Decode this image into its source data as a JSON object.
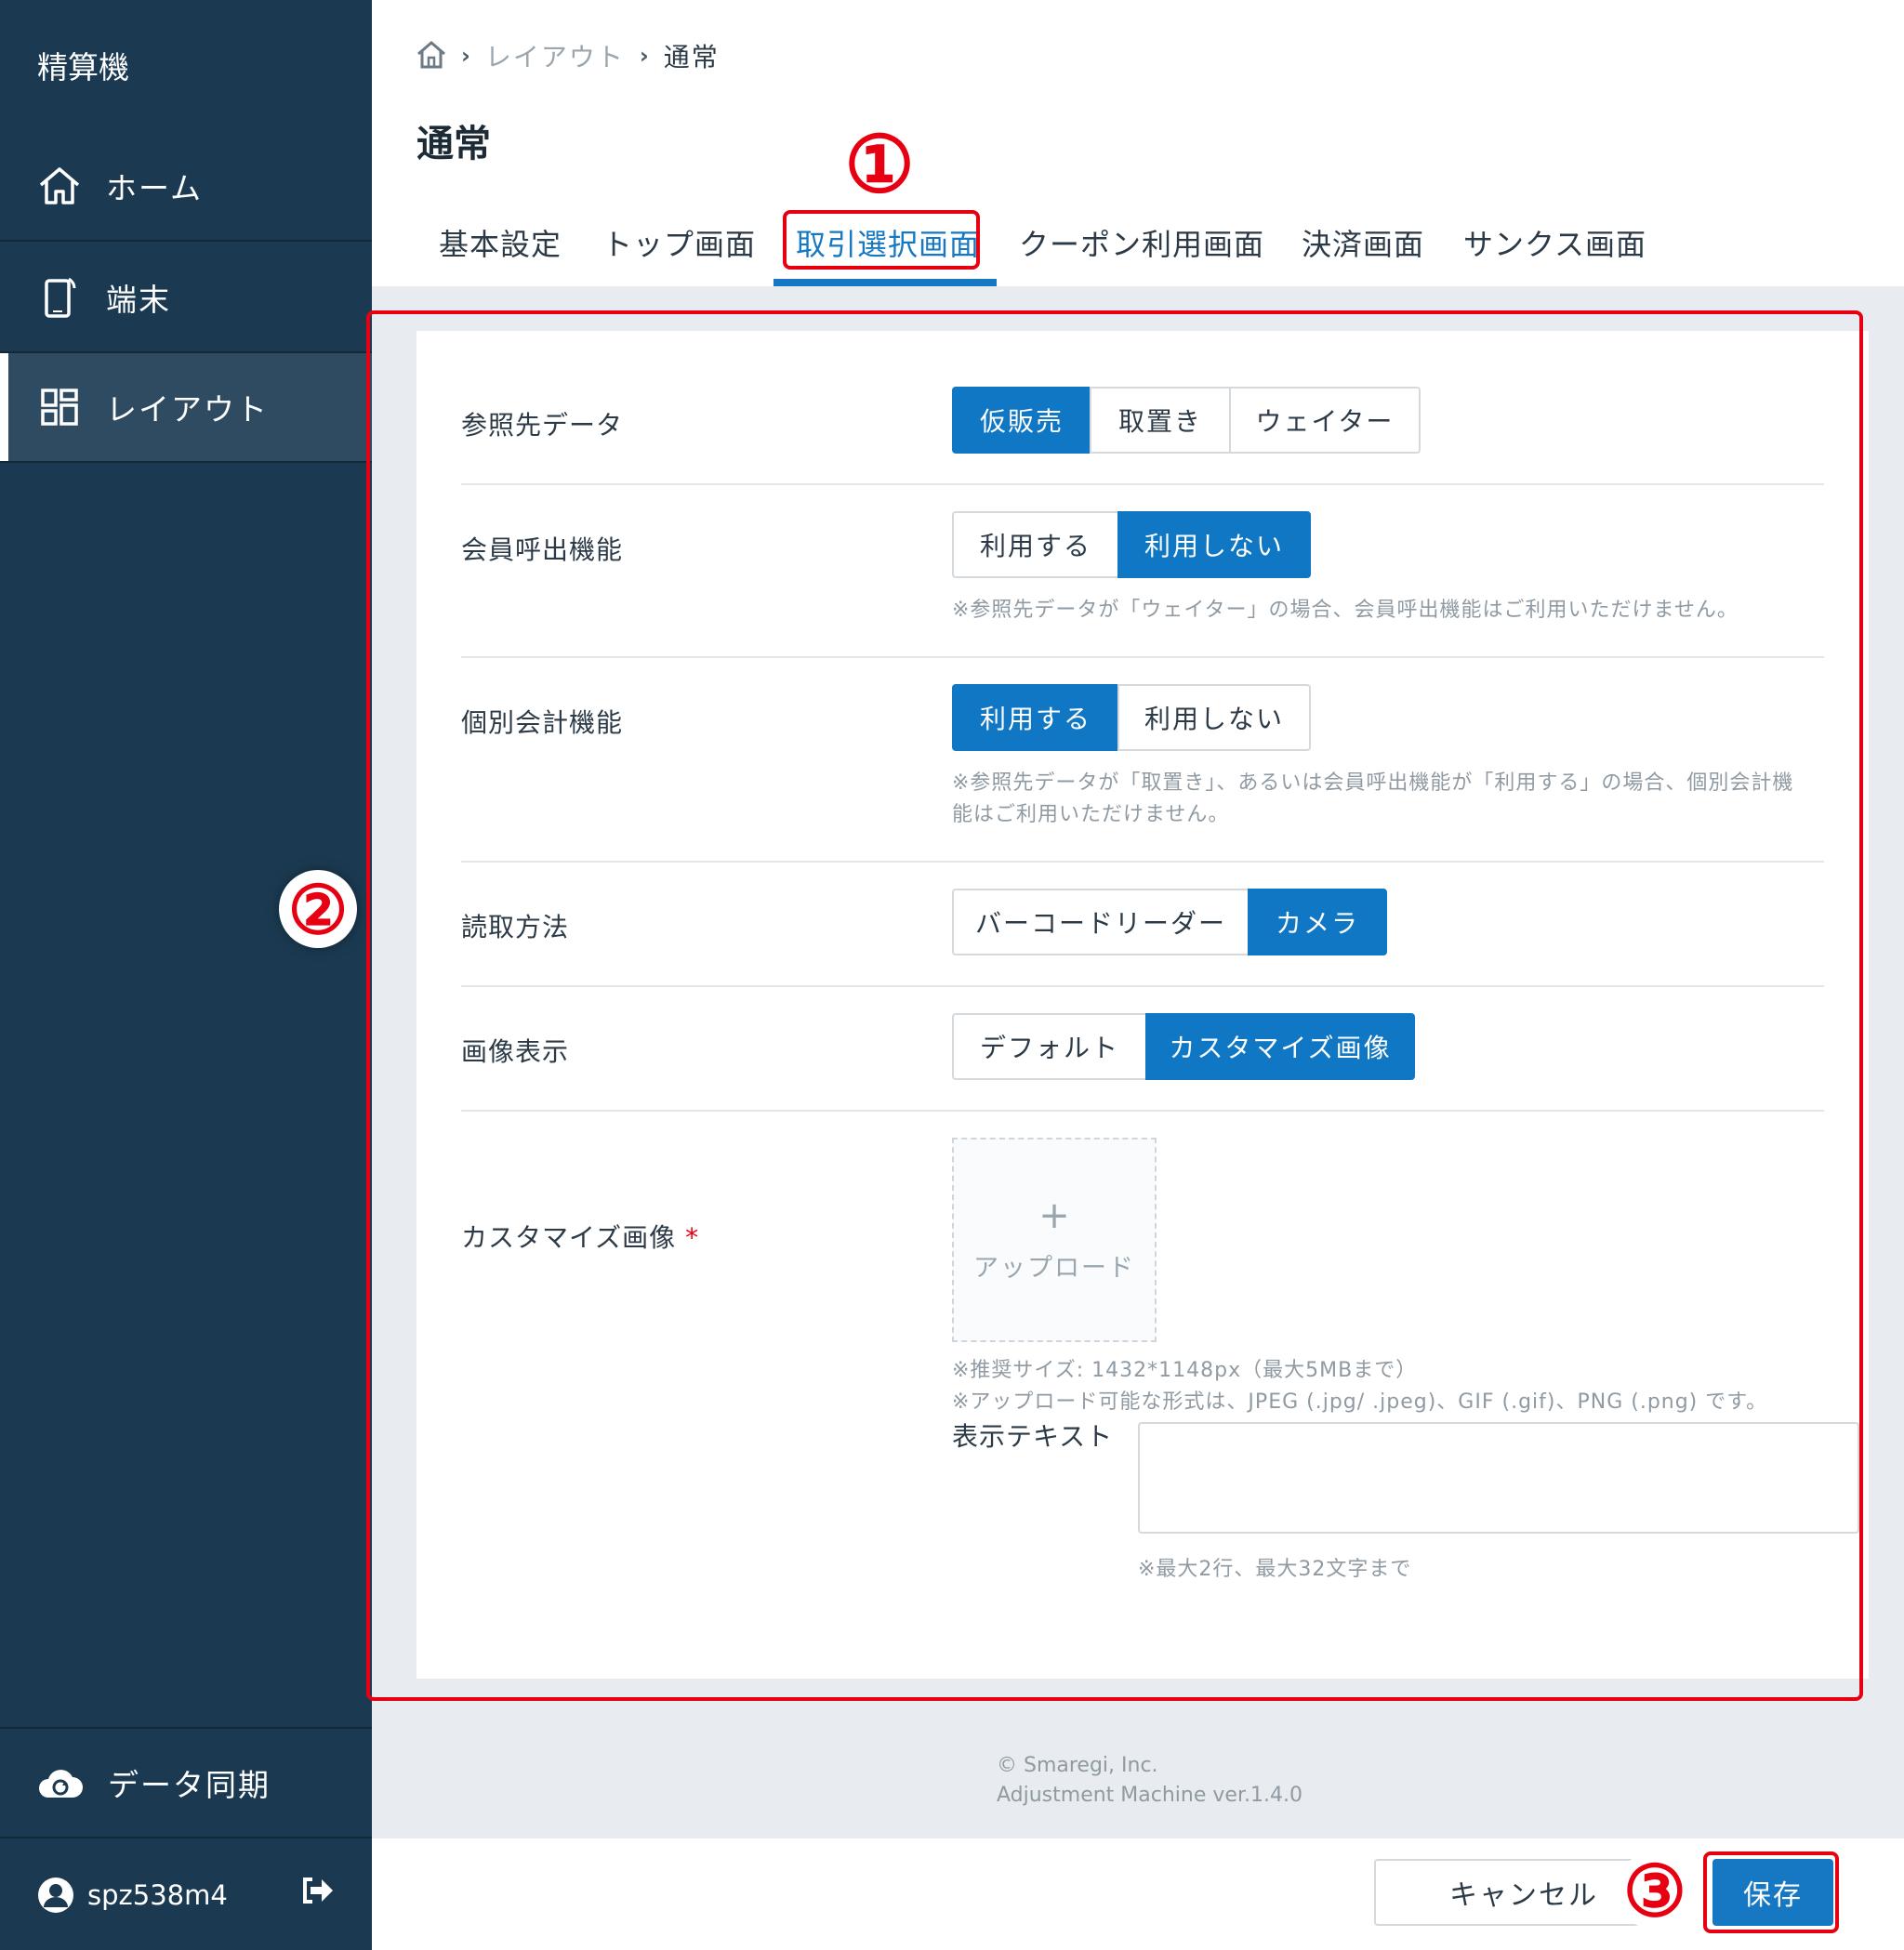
{
  "sidebar": {
    "app_title": "精算機",
    "items": [
      {
        "label": "ホーム",
        "icon": "home-icon"
      },
      {
        "label": "端末",
        "icon": "terminal-icon"
      },
      {
        "label": "レイアウト",
        "icon": "layout-icon",
        "active": true
      }
    ],
    "sync_label": "データ同期",
    "user_name": "spz538m4"
  },
  "breadcrumb": {
    "items": [
      "レイアウト",
      "通常"
    ]
  },
  "page_title": "通常",
  "tabs": [
    {
      "label": "基本設定"
    },
    {
      "label": "トップ画面"
    },
    {
      "label": "取引選択画面",
      "active": true
    },
    {
      "label": "クーポン利用画面"
    },
    {
      "label": "決済画面"
    },
    {
      "label": "サンクス画面"
    }
  ],
  "annotations": {
    "one": "①",
    "two": "②",
    "three": "③"
  },
  "form": {
    "reference_data": {
      "label": "参照先データ",
      "options": [
        "仮販売",
        "取置き",
        "ウェイター"
      ],
      "selected": "仮販売"
    },
    "member_call": {
      "label": "会員呼出機能",
      "options": [
        "利用する",
        "利用しない"
      ],
      "selected": "利用しない",
      "note": "※参照先データが「ウェイター」の場合、会員呼出機能はご利用いただけません。"
    },
    "individual_accounting": {
      "label": "個別会計機能",
      "options": [
        "利用する",
        "利用しない"
      ],
      "selected": "利用する",
      "note_line1": "※参照先データが「取置き」、あるいは会員呼出機能が「利用する」の場合、個別会計機",
      "note_line2": "能はご利用いただけません。"
    },
    "read_method": {
      "label": "読取方法",
      "options": [
        "バーコードリーダー",
        "カメラ"
      ],
      "selected": "カメラ"
    },
    "image_display": {
      "label": "画像表示",
      "options": [
        "デフォルト",
        "カスタマイズ画像"
      ],
      "selected": "カスタマイズ画像"
    },
    "custom_image": {
      "label": "カスタマイズ画像",
      "required_mark": "*",
      "upload_label": "アップロード",
      "upload_plus": "+",
      "note_line1": "※推奨サイズ: 1432*1148px（最大5MBまで）",
      "note_line2": "※アップロード可能な形式は、JPEG (.jpg/ .jpeg)、GIF (.gif)、PNG (.png) です。",
      "display_text_label": "表示テキスト",
      "display_text_value": "",
      "display_text_note": "※最大2行、最大32文字まで"
    }
  },
  "footer": {
    "copyright": "© Smaregi, Inc.",
    "version": "Adjustment Machine ver.1.4.0"
  },
  "actions": {
    "cancel_label": "キャンセル",
    "save_label": "保存"
  },
  "colors": {
    "sidebar_bg": "#1b3a51",
    "accent": "#0f77c3",
    "annotation": "#e60012"
  }
}
